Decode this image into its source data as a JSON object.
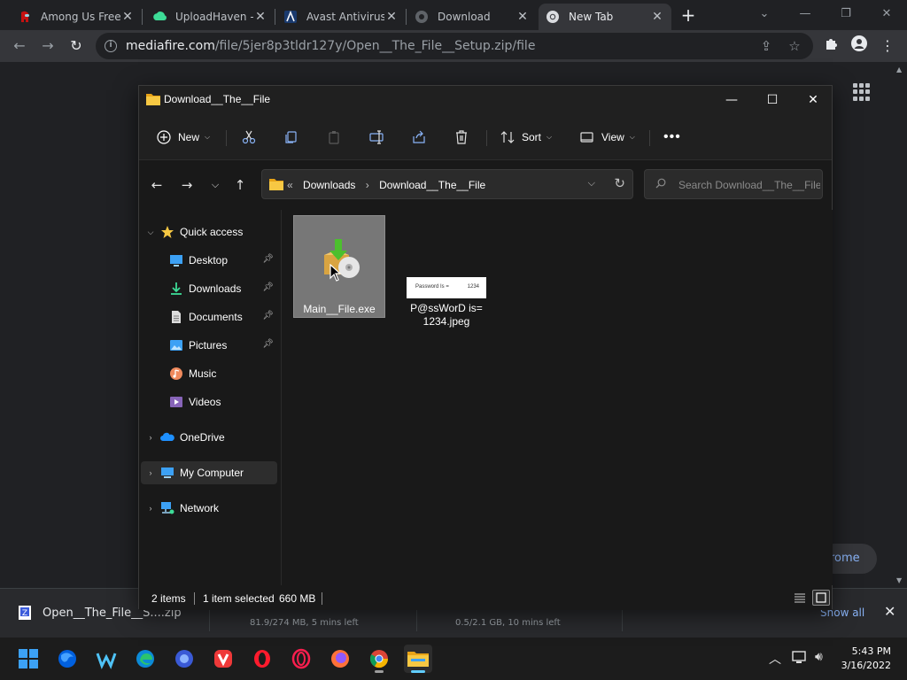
{
  "browser": {
    "tabs": [
      {
        "title": "Among Us Free",
        "icon": "among-us-icon"
      },
      {
        "title": "UploadHaven -",
        "icon": "uploadhaven-icon"
      },
      {
        "title": "Avast Antivirus",
        "icon": "avast-icon"
      },
      {
        "title": "Download",
        "icon": "globe-icon"
      },
      {
        "title": "New Tab",
        "icon": "chrome-icon",
        "active": true
      }
    ],
    "url_domain": "mediafire.com",
    "url_path": "/file/5jer8p3tldr127y/Open__The_File__Setup.zip/file",
    "page_button": "rome"
  },
  "explorer": {
    "title": "Download__The__File",
    "commands": {
      "new": "New",
      "sort": "Sort",
      "view": "View"
    },
    "breadcrumb": {
      "overflow": "«",
      "parts": [
        "Downloads",
        "Download__The__File"
      ]
    },
    "search_placeholder": "Search Download__The__File",
    "nav": {
      "quick_access": "Quick access",
      "desktop": "Desktop",
      "downloads": "Downloads",
      "documents": "Documents",
      "pictures": "Pictures",
      "music": "Music",
      "videos": "Videos",
      "onedrive": "OneDrive",
      "my_computer": "My Computer",
      "network": "Network"
    },
    "files": [
      {
        "name": "Main__File.exe",
        "selected": true
      },
      {
        "name": "P@ssWorD is= 1234.jpeg",
        "selected": false,
        "thumb_left": "Password Is =",
        "thumb_right": "1234"
      }
    ],
    "status": {
      "items": "2 items",
      "selected": "1 item selected",
      "size": "660 MB"
    }
  },
  "downloads_bar": {
    "item1_name": "Open__The_File__S....zip",
    "item2_sub": "81.9/274 MB, 5 mins left",
    "item3_sub": "0.5/2.1 GB, 10 mins left",
    "show_all": "Show all"
  },
  "taskbar": {
    "time": "5:43 PM",
    "date": "3/16/2022"
  },
  "colors": {
    "accent": "#60cdff",
    "link": "#8ab4f8",
    "folder": "#f7c843"
  }
}
